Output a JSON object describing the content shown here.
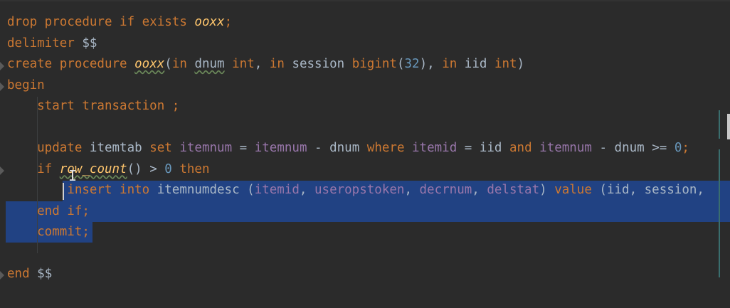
{
  "editor": {
    "language": "sql",
    "lines": [
      {
        "tokens": [
          {
            "t": "drop procedure if exists ",
            "c": "kw"
          },
          {
            "t": "ooxx",
            "c": "fn"
          },
          {
            "t": ";",
            "c": "kw"
          }
        ]
      },
      {
        "tokens": [
          {
            "t": "delimiter ",
            "c": "kw"
          },
          {
            "t": "$$",
            "c": "id"
          }
        ]
      },
      {
        "tokens": [
          {
            "t": "create procedure ",
            "c": "kw"
          },
          {
            "t": "ooxx",
            "c": "fn squiggle"
          },
          {
            "t": "(",
            "c": "punct"
          },
          {
            "t": "in ",
            "c": "kw"
          },
          {
            "t": "dnum",
            "c": "id squiggle"
          },
          {
            "t": " int",
            "c": "kw"
          },
          {
            "t": ", ",
            "c": "punct"
          },
          {
            "t": "in ",
            "c": "kw"
          },
          {
            "t": "session ",
            "c": "id"
          },
          {
            "t": "bigint",
            "c": "kw"
          },
          {
            "t": "(",
            "c": "punct"
          },
          {
            "t": "32",
            "c": "num"
          },
          {
            "t": "), ",
            "c": "punct"
          },
          {
            "t": "in ",
            "c": "kw"
          },
          {
            "t": "iid ",
            "c": "id"
          },
          {
            "t": "int",
            "c": "kw"
          },
          {
            "t": ")",
            "c": "punct"
          }
        ]
      },
      {
        "tokens": [
          {
            "t": "begin",
            "c": "kw"
          }
        ]
      },
      {
        "tokens": [
          {
            "t": "    start transaction ;",
            "c": "kw"
          }
        ]
      },
      {
        "tokens": [
          {
            "t": "",
            "c": "id"
          }
        ]
      },
      {
        "tokens": [
          {
            "t": "    update ",
            "c": "kw"
          },
          {
            "t": "itemtab ",
            "c": "id"
          },
          {
            "t": "set ",
            "c": "kw"
          },
          {
            "t": "itemnum",
            "c": "col"
          },
          {
            "t": " = ",
            "c": "punct"
          },
          {
            "t": "itemnum",
            "c": "col"
          },
          {
            "t": " - ",
            "c": "punct"
          },
          {
            "t": "dnum ",
            "c": "id"
          },
          {
            "t": "where ",
            "c": "kw"
          },
          {
            "t": "itemid",
            "c": "col"
          },
          {
            "t": " = ",
            "c": "punct"
          },
          {
            "t": "iid ",
            "c": "id"
          },
          {
            "t": "and ",
            "c": "kw"
          },
          {
            "t": "itemnum",
            "c": "col"
          },
          {
            "t": " - ",
            "c": "punct"
          },
          {
            "t": "dnum",
            "c": "id"
          },
          {
            "t": " >= ",
            "c": "punct"
          },
          {
            "t": "0",
            "c": "num"
          },
          {
            "t": ";",
            "c": "kw"
          }
        ]
      },
      {
        "tokens": [
          {
            "t": "    if ",
            "c": "kw"
          },
          {
            "t": "row_count",
            "c": "fn squiggle"
          },
          {
            "t": "() > ",
            "c": "punct"
          },
          {
            "t": "0 ",
            "c": "num"
          },
          {
            "t": "then",
            "c": "kw"
          }
        ]
      },
      {
        "tokens": [
          {
            "t": "        insert into ",
            "c": "kw"
          },
          {
            "t": "itemnumdesc ",
            "c": "id"
          },
          {
            "t": "(",
            "c": "punct"
          },
          {
            "t": "itemid",
            "c": "col"
          },
          {
            "t": ", ",
            "c": "punct"
          },
          {
            "t": "useropstoken",
            "c": "col"
          },
          {
            "t": ", ",
            "c": "punct"
          },
          {
            "t": "decrnum",
            "c": "col"
          },
          {
            "t": ", ",
            "c": "punct"
          },
          {
            "t": "delstat",
            "c": "col"
          },
          {
            "t": ") ",
            "c": "punct"
          },
          {
            "t": "value ",
            "c": "kw"
          },
          {
            "t": "(iid, session,",
            "c": "id"
          }
        ]
      },
      {
        "tokens": [
          {
            "t": "    end if;",
            "c": "kw"
          }
        ]
      },
      {
        "tokens": [
          {
            "t": "    commit;",
            "c": "kw"
          }
        ]
      },
      {
        "tokens": [
          {
            "t": "",
            "c": "id"
          }
        ]
      },
      {
        "tokens": [
          {
            "t": "end ",
            "c": "kw"
          },
          {
            "t": "$$",
            "c": "id"
          }
        ]
      }
    ]
  },
  "colors": {
    "background": "#2b2b2b",
    "keyword": "#cc7832",
    "function": "#ffc66d",
    "identifier": "#a9b7c6",
    "column": "#9876aa",
    "number": "#6897bb",
    "selection": "#214283"
  }
}
